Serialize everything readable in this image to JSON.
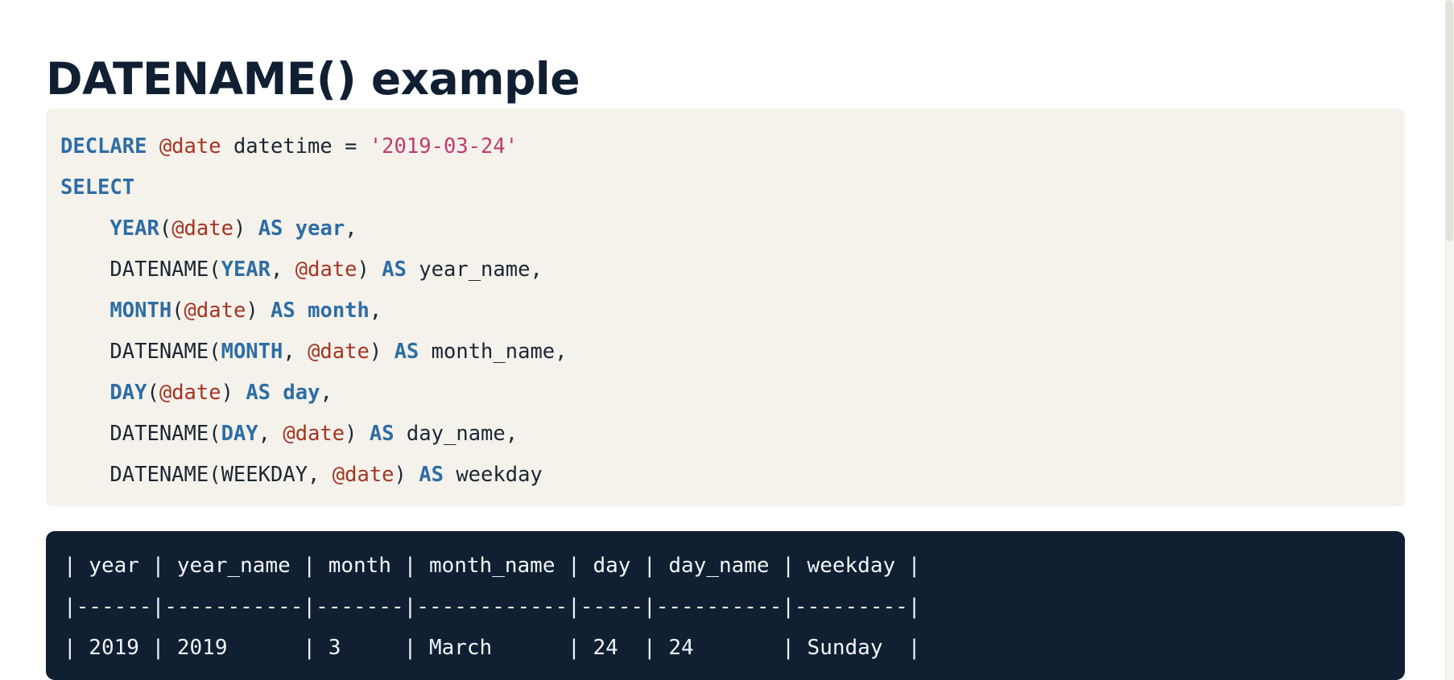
{
  "heading": {
    "title": "DATENAME() example"
  },
  "code_block": {
    "language": "sql",
    "background_color": "#f5f2ec",
    "colors": {
      "keyword": "#2e6da4",
      "variable": "#a43521",
      "string": "#bf3b6b",
      "plain": "#1b2733"
    },
    "lines": [
      [
        {
          "t": "DECLARE",
          "c": "kw"
        },
        {
          "t": " ",
          "c": "plain"
        },
        {
          "t": "@date",
          "c": "var"
        },
        {
          "t": " datetime = ",
          "c": "plain"
        },
        {
          "t": "'2019-03-24'",
          "c": "str"
        }
      ],
      [
        {
          "t": "SELECT",
          "c": "kw"
        }
      ],
      [
        {
          "t": "    ",
          "c": "plain"
        },
        {
          "t": "YEAR",
          "c": "kw"
        },
        {
          "t": "(",
          "c": "punct"
        },
        {
          "t": "@date",
          "c": "var"
        },
        {
          "t": ") ",
          "c": "punct"
        },
        {
          "t": "AS",
          "c": "kw"
        },
        {
          "t": " ",
          "c": "plain"
        },
        {
          "t": "year",
          "c": "kw"
        },
        {
          "t": ",",
          "c": "punct"
        }
      ],
      [
        {
          "t": "    DATENAME(",
          "c": "plain"
        },
        {
          "t": "YEAR",
          "c": "kw"
        },
        {
          "t": ", ",
          "c": "punct"
        },
        {
          "t": "@date",
          "c": "var"
        },
        {
          "t": ") ",
          "c": "punct"
        },
        {
          "t": "AS",
          "c": "kw"
        },
        {
          "t": " year_name,",
          "c": "plain"
        }
      ],
      [
        {
          "t": "    ",
          "c": "plain"
        },
        {
          "t": "MONTH",
          "c": "kw"
        },
        {
          "t": "(",
          "c": "punct"
        },
        {
          "t": "@date",
          "c": "var"
        },
        {
          "t": ") ",
          "c": "punct"
        },
        {
          "t": "AS",
          "c": "kw"
        },
        {
          "t": " ",
          "c": "plain"
        },
        {
          "t": "month",
          "c": "kw"
        },
        {
          "t": ",",
          "c": "punct"
        }
      ],
      [
        {
          "t": "    DATENAME(",
          "c": "plain"
        },
        {
          "t": "MONTH",
          "c": "kw"
        },
        {
          "t": ", ",
          "c": "punct"
        },
        {
          "t": "@date",
          "c": "var"
        },
        {
          "t": ") ",
          "c": "punct"
        },
        {
          "t": "AS",
          "c": "kw"
        },
        {
          "t": " month_name,",
          "c": "plain"
        }
      ],
      [
        {
          "t": "    ",
          "c": "plain"
        },
        {
          "t": "DAY",
          "c": "kw"
        },
        {
          "t": "(",
          "c": "punct"
        },
        {
          "t": "@date",
          "c": "var"
        },
        {
          "t": ") ",
          "c": "punct"
        },
        {
          "t": "AS",
          "c": "kw"
        },
        {
          "t": " ",
          "c": "plain"
        },
        {
          "t": "day",
          "c": "kw"
        },
        {
          "t": ",",
          "c": "punct"
        }
      ],
      [
        {
          "t": "    DATENAME(",
          "c": "plain"
        },
        {
          "t": "DAY",
          "c": "kw"
        },
        {
          "t": ", ",
          "c": "punct"
        },
        {
          "t": "@date",
          "c": "var"
        },
        {
          "t": ") ",
          "c": "punct"
        },
        {
          "t": "AS",
          "c": "kw"
        },
        {
          "t": " day_name,",
          "c": "plain"
        }
      ],
      [
        {
          "t": "    DATENAME(WEEKDAY, ",
          "c": "plain"
        },
        {
          "t": "@date",
          "c": "var"
        },
        {
          "t": ") ",
          "c": "punct"
        },
        {
          "t": "AS",
          "c": "kw"
        },
        {
          "t": " weekday",
          "c": "plain"
        }
      ]
    ]
  },
  "output_block": {
    "background_color": "#111f33",
    "text_color": "#f2f5f8",
    "columns": [
      "year",
      "year_name",
      "month",
      "month_name",
      "day",
      "day_name",
      "weekday"
    ],
    "rows": [
      [
        "2019",
        "2019",
        "3",
        "March",
        "24",
        "24",
        "Sunday"
      ]
    ],
    "lines": [
      "| year | year_name | month | month_name | day | day_name | weekday |",
      "|------|-----------|-------|------------|-----|----------|---------|",
      "| 2019 | 2019      | 3     | March      | 24  | 24       | Sunday  |"
    ]
  }
}
